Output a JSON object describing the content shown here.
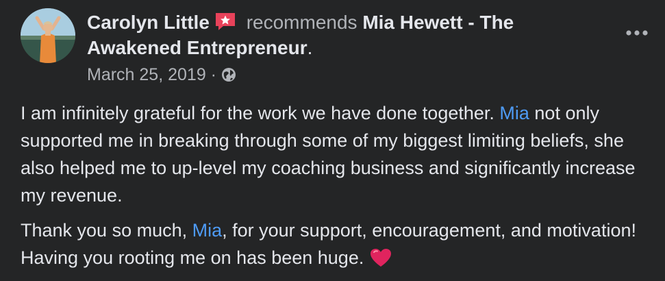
{
  "post": {
    "author": "Carolyn Little",
    "verb": "recommends",
    "target": "Mia Hewett - The Awakened Entrepreneur",
    "target_suffix": ".",
    "date": "March 25, 2019",
    "date_separator": " · ",
    "privacy_icon": "globe-icon",
    "badge_icon": "recommendation-star-icon",
    "menu_icon": "more-options-icon"
  },
  "body": {
    "p1": {
      "a": "I am infinitely grateful for the work we have done together. ",
      "mention": "Mia",
      "b": " not only supported me in breaking through some of my biggest limiting beliefs, she also helped me to up-level my coaching business and significantly increase my revenue."
    },
    "p2": {
      "a": "Thank you so much, ",
      "mention": "Mia",
      "b": ", for your support, encouragement, and motivation! Having you rooting me on has been huge. ",
      "emoji": "heart-emoji"
    }
  },
  "colors": {
    "background": "#242526",
    "primary_text": "#e4e6eb",
    "secondary_text": "#b0b3b8",
    "mention": "#4e9bf5",
    "badge": "#e8425a",
    "heart": "#e0245e"
  }
}
